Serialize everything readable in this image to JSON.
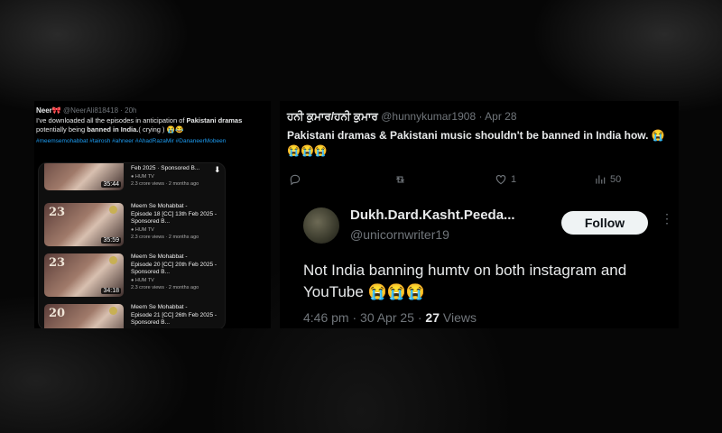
{
  "left_tweet": {
    "name": "Neer🎀",
    "handle": "@NeerAli818418",
    "time": "20h",
    "text_a": "I've downloaded all the episodes in anticipation of ",
    "text_b": "Pakistani dramas",
    "text_c": " potentially being ",
    "text_d": "banned in India.",
    "text_e": "( crying ) 😭😂",
    "hashtags": "#meemsemohabbat #tairosh #ahneer #AhadRazaMir #DananeerMobeen",
    "videos": [
      {
        "num": "",
        "duration": "35:44",
        "title": "",
        "line2": "Feb 2025 · Sponsored B...",
        "channel": "● HUM TV",
        "stats": "2.3 crore views · 2 months ago"
      },
      {
        "num": "23",
        "duration": "35:59",
        "title": "Meem Se Mohabbat -",
        "line2": "Episode 18 [CC] 13th Feb 2025 - Sponsored B...",
        "channel": "● HUM TV",
        "stats": "2.3 crore views · 2 months ago"
      },
      {
        "num": "23",
        "duration": "34:18",
        "title": "Meem Se Mohabbat -",
        "line2": "Episode 20 [CC] 20th Feb 2025 - Sponsored B...",
        "channel": "● HUM TV",
        "stats": "2.3 crore views · 2 months ago"
      },
      {
        "num": "20",
        "duration": "",
        "title": "Meem Se Mohabbat -",
        "line2": "Episode 21 [CC] 26th Feb 2025 - Sponsored B...",
        "channel": "",
        "stats": ""
      }
    ]
  },
  "right_tweet": {
    "name": "ਹਨੀ ਕੁਮਾਰ/ਹਨੀ ਕੁਮਾਰ",
    "handle": "@hunnykumar1908",
    "time": "Apr 28",
    "text": "Pakistani dramas & Pakistani music shouldn't be banned in India how. 😭😭😭😭",
    "reply_count": "",
    "retweet_count": "",
    "like_count": "1",
    "views_count": "50"
  },
  "quote_tweet": {
    "name": "Dukh.Dard.Kasht.Peeda...",
    "handle": "@unicornwriter19",
    "follow_label": "Follow",
    "text": "Not India banning humtv on both instagram and YouTube 😭😭😭",
    "time": "4:46 pm · 30 Apr 25 · ",
    "views": "27",
    "views_label": " Views"
  },
  "colors": {
    "accent": "#1d9bf0",
    "muted": "#71767b",
    "text": "#e7e9ea",
    "bg": "#000000"
  }
}
